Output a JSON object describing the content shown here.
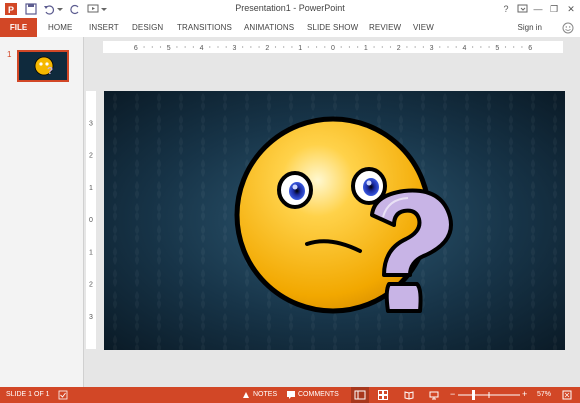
{
  "window": {
    "title": "Presentation1 - PowerPoint",
    "help": "?",
    "minimize": "—",
    "restore": "❐",
    "close": "✕"
  },
  "ribbon": {
    "file": "FILE",
    "tabs": [
      "HOME",
      "INSERT",
      "DESIGN",
      "TRANSITIONS",
      "ANIMATIONS",
      "SLIDE SHOW",
      "REVIEW",
      "VIEW"
    ],
    "sign_in": "Sign in"
  },
  "slides_pane": {
    "slide_number": "1"
  },
  "ruler": {
    "horizontal": [
      "6",
      "5",
      "4",
      "3",
      "2",
      "1",
      "0",
      "1",
      "2",
      "3",
      "4",
      "5",
      "6"
    ],
    "vertical": [
      "3",
      "2",
      "1",
      "0",
      "1",
      "2",
      "3"
    ]
  },
  "status": {
    "slide": "SLIDE 1 OF 1",
    "notes": "NOTES",
    "comments": "COMMENTS",
    "zoom": "57%",
    "zoom_minus": "−",
    "zoom_plus": "+"
  },
  "colors": {
    "accent": "#d24726",
    "face": "#f5b800",
    "question_mark": "#c8b4e6"
  }
}
